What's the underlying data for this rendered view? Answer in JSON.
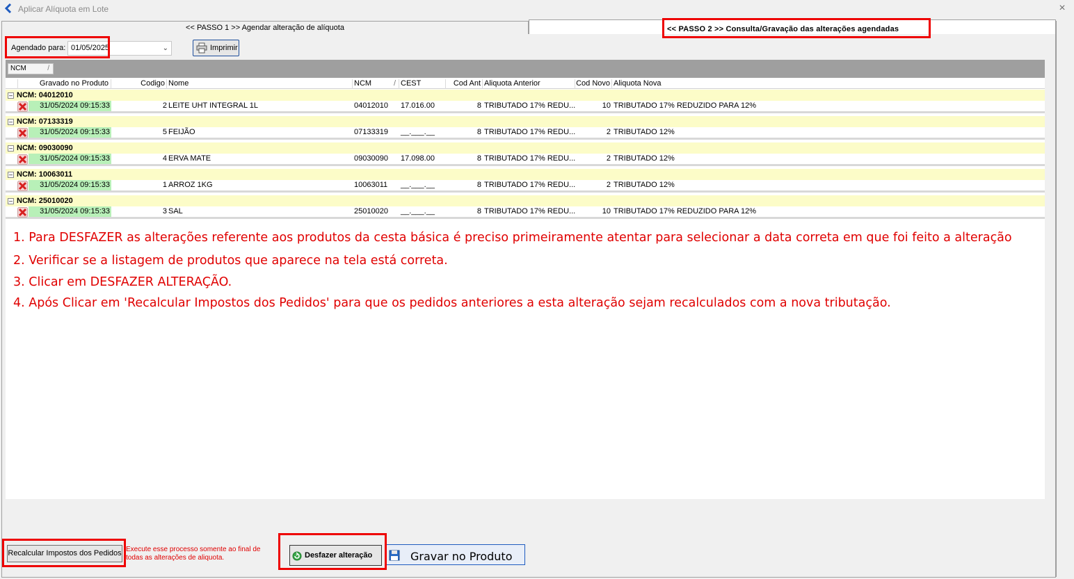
{
  "window": {
    "title": "Aplicar Alíquota em Lote",
    "close_icon": "×"
  },
  "tabs": [
    {
      "label": "<< PASSO 1 >> Agendar alteração de alíquota"
    },
    {
      "label": "<< PASSO 2 >> Consulta/Gravação das alterações agendadas"
    }
  ],
  "filter": {
    "label": "Agendado para:",
    "date_value": "01/05/2025"
  },
  "toolbar": {
    "print_label": "Imprimir"
  },
  "grid": {
    "group_chip": "NCM",
    "group_chip_sort": "/",
    "columns": {
      "gravado": "Gravado no Produto",
      "codigo": "Codigo",
      "nome": "Nome",
      "ncm": "NCM",
      "ncm_sort": "/",
      "cest": "CEST",
      "cod_ant": "Cod Ant",
      "aliq_ant": "Aliquota Anterior",
      "cod_novo": "Cod Novo",
      "aliq_nova": "Aliquota Nova"
    },
    "groups": [
      {
        "label": "NCM: 04012010",
        "row": {
          "gravado": "31/05/2024 09:15:33",
          "codigo": "2",
          "nome": "LEITE UHT INTEGRAL 1L",
          "ncm": "04012010",
          "cest": "17.016.00",
          "cod_ant": "8",
          "aliq_ant": "TRIBUTADO 17% REDU...",
          "cod_novo": "10",
          "aliq_nova": "TRIBUTADO 17% REDUZIDO PARA 12%"
        }
      },
      {
        "label": "NCM: 07133319",
        "row": {
          "gravado": "31/05/2024 09:15:33",
          "codigo": "5",
          "nome": "FEIJÃO",
          "ncm": "07133319",
          "cest": "__.___.__",
          "cod_ant": "8",
          "aliq_ant": "TRIBUTADO 17% REDU...",
          "cod_novo": "2",
          "aliq_nova": "TRIBUTADO 12%"
        }
      },
      {
        "label": "NCM: 09030090",
        "row": {
          "gravado": "31/05/2024 09:15:33",
          "codigo": "4",
          "nome": "ERVA MATE",
          "ncm": "09030090",
          "cest": "17.098.00",
          "cod_ant": "8",
          "aliq_ant": "TRIBUTADO 17% REDU...",
          "cod_novo": "2",
          "aliq_nova": "TRIBUTADO 12%"
        }
      },
      {
        "label": "NCM: 10063011",
        "row": {
          "gravado": "31/05/2024 09:15:33",
          "codigo": "1",
          "nome": "ARROZ 1KG",
          "ncm": "10063011",
          "cest": "__.___.__",
          "cod_ant": "8",
          "aliq_ant": "TRIBUTADO 17% REDU...",
          "cod_novo": "2",
          "aliq_nova": "TRIBUTADO 12%"
        }
      },
      {
        "label": "NCM: 25010020",
        "row": {
          "gravado": "31/05/2024 09:15:33",
          "codigo": "3",
          "nome": "SAL",
          "ncm": "25010020",
          "cest": "__.___.__",
          "cod_ant": "8",
          "aliq_ant": "TRIBUTADO 17% REDU...",
          "cod_novo": "10",
          "aliq_nova": "TRIBUTADO 17% REDUZIDO PARA 12%"
        }
      }
    ]
  },
  "instructions": [
    "1. Para DESFAZER as alterações referente aos produtos da cesta básica é preciso primeiramente atentar para selecionar a data correta em que foi feito a alteração",
    "2. Verificar se a listagem de produtos que aparece na tela está correta.",
    "3. Clicar em DESFAZER ALTERAÇÃO.",
    "4. Após Clicar em 'Recalcular Impostos dos Pedidos' para que os pedidos anteriores a esta alteração sejam recalculados com a nova tributação."
  ],
  "footer": {
    "recalc_label": "Recalcular Impostos dos Pedidos",
    "recalc_note_line1": "Execute esse processo somente ao final de",
    "recalc_note_line2": "todas as alterações de aliquota.",
    "undo_label": "Desfazer alteração",
    "save_label": "Gravar no Produto"
  },
  "colors": {
    "highlight_red": "#ee0000",
    "group_row": "#fcfcc8",
    "gravado_cell": "#b8f0b8",
    "instruction_text": "#e00000"
  }
}
